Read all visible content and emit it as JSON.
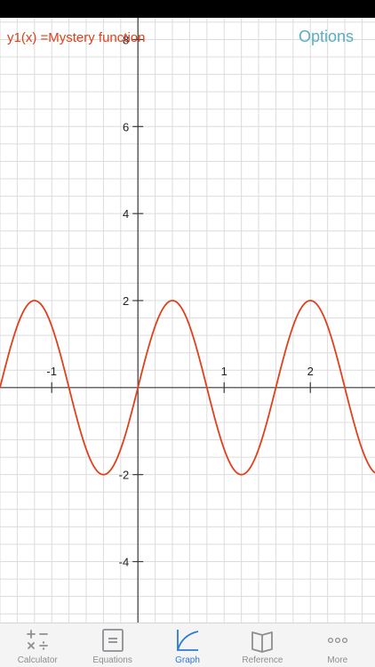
{
  "function_label": "y1(x) =Mystery function",
  "options_label": "Options",
  "colors": {
    "curve": "#e0401c",
    "grid": "#dcdcdc",
    "axis": "#3a3a3a",
    "accent": "#2d7ad6",
    "inactive_tab": "#8e8e93"
  },
  "chart_data": {
    "type": "line",
    "x_tick_labels": [
      "-1",
      "1",
      "2"
    ],
    "y_tick_labels": [
      "-4",
      "-2",
      "2",
      "4",
      "6",
      "8"
    ],
    "xlim": [
      -1.6,
      2.75
    ],
    "ylim": [
      -5.4,
      8.5
    ],
    "grid": true,
    "series": [
      {
        "amplitude": 2,
        "period": 1.6,
        "x": [
          -1.6,
          -1.2,
          -0.8,
          -0.4,
          0,
          0.4,
          0.8,
          1.2,
          1.6,
          2.0,
          2.4,
          2.75
        ],
        "y": [
          0,
          2,
          0,
          -2,
          0,
          2,
          0,
          -2,
          0,
          2,
          0,
          -1.98
        ]
      }
    ]
  },
  "tabs": [
    {
      "label": "Calculator",
      "icon": "calculator-icon"
    },
    {
      "label": "Equations",
      "icon": "equations-icon"
    },
    {
      "label": "Graph",
      "icon": "graph-icon"
    },
    {
      "label": "Reference",
      "icon": "reference-book-icon"
    },
    {
      "label": "More",
      "icon": "more-dots-icon"
    }
  ],
  "active_tab": "Graph"
}
